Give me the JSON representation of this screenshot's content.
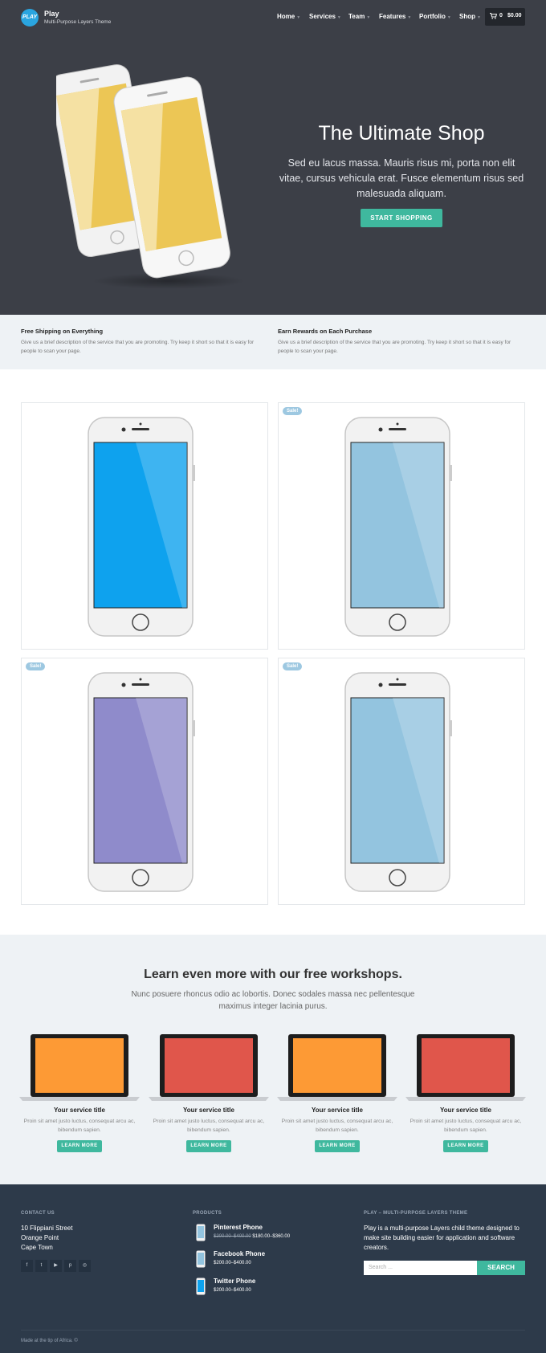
{
  "header": {
    "logo_text": "PLAY",
    "site_title": "Play",
    "tagline": "Multi-Purpose Layers Theme",
    "nav": [
      {
        "label": "Home"
      },
      {
        "label": "Services"
      },
      {
        "label": "Team"
      },
      {
        "label": "Features"
      },
      {
        "label": "Portfolio"
      },
      {
        "label": "Shop"
      }
    ],
    "cart_count": "0",
    "cart_total": "$0.00"
  },
  "hero": {
    "title": "The Ultimate Shop",
    "text": "Sed eu lacus massa. Mauris risus mi, porta non elit vitae, cursus vehicula erat. Fusce elementum risus sed malesuada aliquam.",
    "button": "START SHOPPING"
  },
  "features": [
    {
      "title": "Free Shipping on Everything",
      "text": "Give us a brief description of the service that you are promoting. Try keep it short so that it is easy for people to scan your page."
    },
    {
      "title": "Earn Rewards on Each Purchase",
      "text": "Give us a brief description of the service that you are promoting. Try keep it short so that it is easy for people to scan your page."
    }
  ],
  "products": [
    {
      "sale": "",
      "screen_color": "#0ea2ee"
    },
    {
      "sale": "Sale!",
      "screen_color": "#93c4df"
    },
    {
      "sale": "Sale!",
      "screen_color": "#8f8bcb"
    },
    {
      "sale": "Sale!",
      "screen_color": "#93c4df"
    }
  ],
  "workshops": {
    "title": "Learn even more with our free workshops.",
    "text": "Nunc posuere rhoncus odio ac lobortis. Donec sodales massa nec pellentesque maximus integer lacinia purus.",
    "services": [
      {
        "title": "Your service title",
        "text": "Proin sit amet justo luctus, consequat arcu ac, bibendum sapien.",
        "button": "LEARN MORE",
        "screen_color": "#fd9a35"
      },
      {
        "title": "Your service title",
        "text": "Proin sit amet justo luctus, consequat arcu ac, bibendum sapien.",
        "button": "LEARN MORE",
        "screen_color": "#e0564b"
      },
      {
        "title": "Your service title",
        "text": "Proin sit amet justo luctus, consequat arcu ac, bibendum sapien.",
        "button": "LEARN MORE",
        "screen_color": "#fd9a35"
      },
      {
        "title": "Your service title",
        "text": "Proin sit amet justo luctus, consequat arcu ac, bibendum sapien.",
        "button": "LEARN MORE",
        "screen_color": "#e0564b"
      }
    ]
  },
  "footer": {
    "contact_heading": "CONTACT US",
    "address": [
      "10 Flippiani Street",
      "Orange Point",
      "Cape Town"
    ],
    "socials": [
      "facebook-icon",
      "twitter-icon",
      "youtube-icon",
      "pinterest-icon",
      "dribbble-icon"
    ],
    "products_heading": "PRODUCTS",
    "products": [
      {
        "name": "Pinterest Phone",
        "old_price": "$200.00–$400.00",
        "price": "$180.00–$360.00"
      },
      {
        "name": "Facebook Phone",
        "old_price": "",
        "price": "$200.00–$400.00"
      },
      {
        "name": "Twitter Phone",
        "old_price": "",
        "price": "$200.00–$400.00"
      }
    ],
    "about_heading": "PLAY – MULTI-PURPOSE LAYERS THEME",
    "about_text": "Play is a multi-purpose Layers child theme designed to make site building easier for application and software creators.",
    "search_placeholder": "Search ...",
    "search_button": "SEARCH",
    "credit": "Made at the tip of Africa. ©"
  },
  "colors": {
    "hero_bg": "#3c3f47",
    "accent": "#3fb89e",
    "strip_bg": "#eef2f5",
    "footer_bg": "#2d3a4a"
  }
}
